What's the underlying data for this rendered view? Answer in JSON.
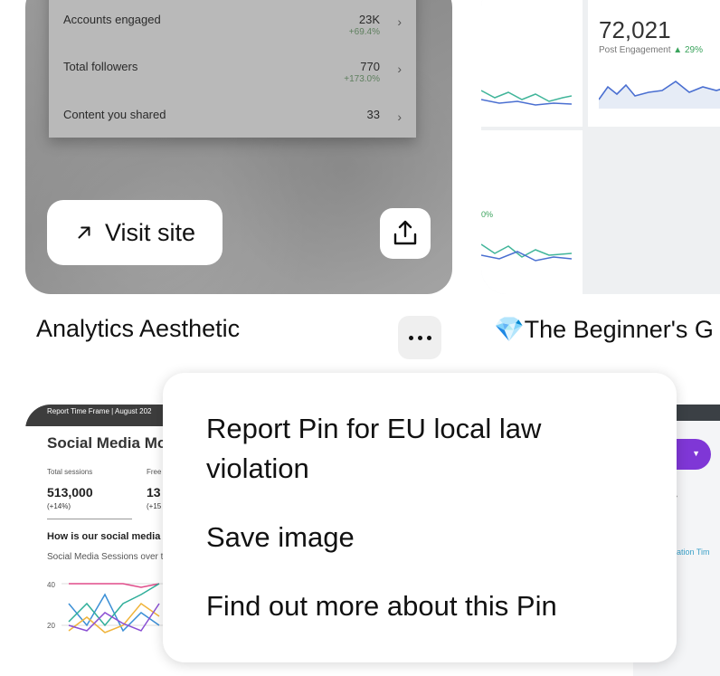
{
  "pin1": {
    "stats": [
      {
        "label": "Accounts engaged",
        "value": "23K",
        "change": "+69.4%"
      },
      {
        "label": "Total followers",
        "value": "770",
        "change": "+173.0%"
      },
      {
        "label": "Content you shared",
        "value": "33",
        "change": ""
      }
    ],
    "visit_label": "Visit site",
    "title": "Analytics Aesthetic"
  },
  "pin2": {
    "big_number": "72,021",
    "sub_label": "Post Engagement",
    "sub_change": "▲ 29%",
    "side_pct": "0%",
    "title": "💎The Beginner's G"
  },
  "pin3": {
    "header": "Report Time Frame  |  August 202",
    "title": "Social Media Mo",
    "stat1_label": "Total sessions",
    "stat1_value": "513,000",
    "stat1_change": "(+14%)",
    "stat2_label": "Free",
    "stat2_value": "13",
    "stat2_change": "(+15",
    "question": "How is our social media",
    "subtitle": "Social Media Sessions over th",
    "axis_40": "40",
    "axis_20": "20"
  },
  "pin4": {
    "caption": "ation Tim"
  },
  "menu": {
    "items": [
      "Report Pin for EU local law violation",
      "Save image",
      "Find out more about this Pin"
    ]
  },
  "colors": {
    "accent_purple": "#7f37d6",
    "positive_green": "#3aa35c"
  }
}
